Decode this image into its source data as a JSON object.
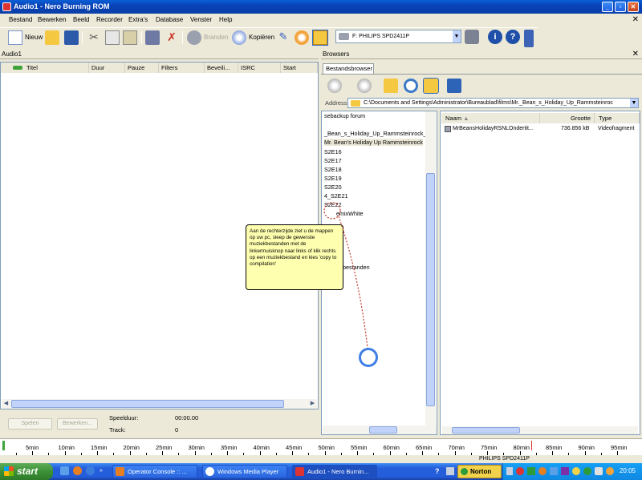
{
  "window": {
    "title": "Audio1 - Nero Burning ROM"
  },
  "menu": [
    "Bestand",
    "Bewerken",
    "Beeld",
    "Recorder",
    "Extra's",
    "Database",
    "Venster",
    "Help"
  ],
  "toolbar": {
    "new_label": "Nieuw",
    "burn_label": "Branden",
    "copy_label": "Kopiëren",
    "drive": "F: PHILIPS SPD2411P"
  },
  "left_pane": {
    "title": "Audio1",
    "columns": [
      "Titel",
      "Duur",
      "Pauze",
      "Filters",
      "Beveili...",
      "ISRC",
      "Start"
    ]
  },
  "player": {
    "play_label": "Spelen",
    "edit_label": "Bewerken...",
    "playtime_label": "Speelduur:",
    "playtime_value": "00:00.00",
    "track_label": "Track:",
    "track_value": "0"
  },
  "right_pane": {
    "title": "Browsers",
    "tab": "Bestandsbrowser",
    "address_label": "Address",
    "address_value": "C:\\Documents and Settings\\Administrator\\Bureaublad\\films\\Mr._Bean_s_Holiday_Up_Rammsteinroc",
    "tree_items": [
      "sebackup forum",
      "_Bean_s_Holiday_Up_Rammsteinrock_",
      "Mr. Bean's Holiday Up Rammsteinrock",
      "S2E16",
      "S2E17",
      "S2E18",
      "S2E19",
      "S2E20",
      "4_S2E21",
      "S2E22",
      "emixWhite",
      "bestanden"
    ],
    "file_columns": [
      "Naam",
      "Grootte",
      "Type"
    ],
    "files": [
      {
        "name": "MrBeansHolidayRSNLOndertit...",
        "size": "736.856 kB",
        "type": "Videofragment"
      }
    ]
  },
  "tooltip": "Aan de rechterzijde ziet u de mappen op uw pc, sleep de gewenste muziekbestanden met de linkermuisknop naar links of klik rechts op een muziekbestand en kies 'copy to compilation'",
  "timeline": [
    "5min",
    "10min",
    "15min",
    "20min",
    "25min",
    "30min",
    "35min",
    "40min",
    "45min",
    "50min",
    "55min",
    "60min",
    "65min",
    "70min",
    "75min",
    "80min",
    "85min",
    "90min",
    "95min"
  ],
  "status": {
    "drive": "PHILIPS  SPD2411P"
  },
  "taskbar": {
    "start_label": "start",
    "tasks": [
      "Operator Console :: ...",
      "Windows Media Player",
      "Audio1 - Nero Burnin..."
    ],
    "tray_app": "Norton",
    "clock": "20:05"
  },
  "colors": {
    "titlebar": "#0a5fd6",
    "tooltip": "#ffffb0",
    "taskbar": "#245edb",
    "start": "#3c9137"
  }
}
